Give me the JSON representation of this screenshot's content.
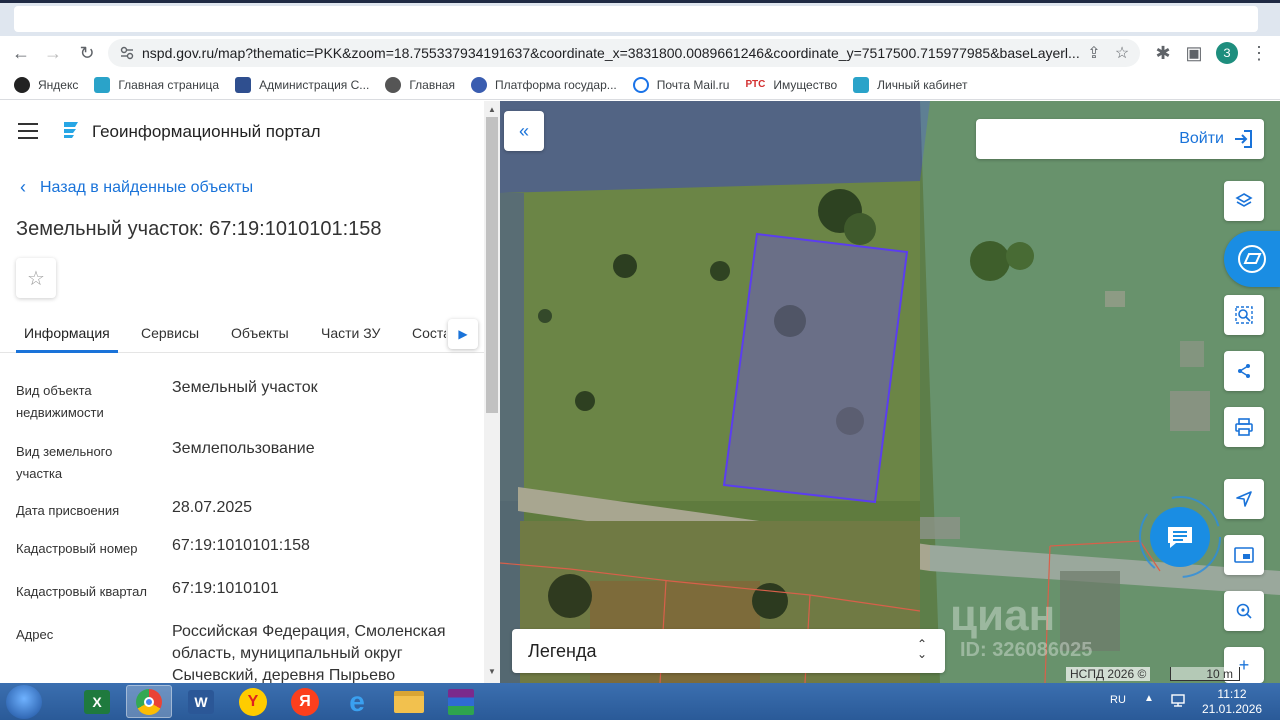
{
  "browser": {
    "url": "nspd.gov.ru/map?thematic=PKK&zoom=18.755337934191637&coordinate_x=3831800.0089661246&coordinate_y=7517500.715977985&baseLayerl...",
    "profile_initial": "З"
  },
  "bookmarks": [
    {
      "label": "Яндекс",
      "color": "#222222"
    },
    {
      "label": "Главная страница",
      "color": "#2aa3c9"
    },
    {
      "label": "Администрация С...",
      "color": "#2f4f8f"
    },
    {
      "label": "Главная",
      "color": "#555555"
    },
    {
      "label": "Платформа государ...",
      "color": "#3a5db0"
    },
    {
      "label": "Почта Mail.ru",
      "color": "#1a73e8"
    },
    {
      "label": "Имущество",
      "color": "#d32f2f",
      "badge": "РТС"
    },
    {
      "label": "Личный кабинет",
      "color": "#2aa3c9"
    }
  ],
  "panel": {
    "portal_title": "Геоинформационный портал",
    "back_label": "Назад в найденные объекты",
    "object_title": "Земельный участок: 67:19:1010101:158",
    "tabs": [
      "Информация",
      "Сервисы",
      "Объекты",
      "Части ЗУ",
      "Соста"
    ],
    "info": [
      {
        "label": "Вид объекта недвижимости",
        "value": "Земельный участок"
      },
      {
        "label": "Вид земельного участка",
        "value": "Землепользование"
      },
      {
        "label": "Дата присвоения",
        "value": "28.07.2025"
      },
      {
        "label": "Кадастровый номер",
        "value": "67:19:1010101:158"
      },
      {
        "label": "Кадастровый квартал",
        "value": "67:19:1010101"
      },
      {
        "label": "Адрес",
        "value": "Российская Федерация, Смоленская область, муниципальный округ Сычевский, деревня Пырьево"
      }
    ]
  },
  "map": {
    "login_label": "Войти",
    "legend_label": "Легенда",
    "copyright": "НСПД 2026 ©",
    "scale_label": "10 m",
    "watermark_main": "циан",
    "watermark_id": "ID: 326086025",
    "parcel_color": "#5b3df0",
    "accent": "#1a73d9"
  },
  "taskbar": {
    "language": "RU",
    "time": "11:12",
    "date": "21.01.2026"
  }
}
